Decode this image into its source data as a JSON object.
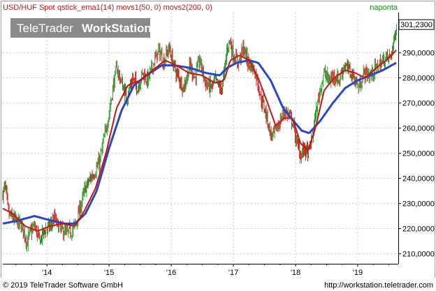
{
  "header": {
    "instrument": "USD/HUF Spot",
    "indicators": "qstick_ema1(14) movs1(50, 0) movs2(200, 0)",
    "frequency": "naponta"
  },
  "logo": {
    "part1": "TeleTrader",
    "part2": "WorkStation"
  },
  "footer": {
    "copyright": "© 2019 TeleTrader Software GmbH",
    "url": "http://workstation.teletrader.com"
  },
  "colors": {
    "up_candle": "#2e9b2e",
    "down_candle": "#cc1e1e",
    "movs1": "#c81414",
    "movs2": "#2a46c8",
    "grid": "#c9c9c9",
    "axis": "#000000",
    "logo_bg": "#8a8a8a",
    "header_text": "#c81414",
    "frequency_text": "#1a8c1a"
  },
  "chart_data": {
    "type": "candlestick",
    "x_axis_labels": [
      "'14",
      "'15",
      "'16",
      "'17",
      "'18",
      "'19"
    ],
    "y_tick_labels": [
      "210,0000",
      "220,0000",
      "230,0000",
      "240,0000",
      "250,0000",
      "260,0000",
      "270,0000",
      "280,0000",
      "290,0000"
    ],
    "ylim": [
      206,
      306
    ],
    "last_price_label": "301,2300",
    "last_price": 301.23,
    "grid": true,
    "price_series_name": "USD/HUF Spot",
    "price_anchors": [
      [
        2013.29,
        234
      ],
      [
        2013.33,
        237
      ],
      [
        2013.38,
        226
      ],
      [
        2013.45,
        224
      ],
      [
        2013.55,
        222
      ],
      [
        2013.62,
        220
      ],
      [
        2013.68,
        214
      ],
      [
        2013.72,
        218
      ],
      [
        2013.8,
        221
      ],
      [
        2013.88,
        215
      ],
      [
        2013.95,
        219
      ],
      [
        2014.05,
        221
      ],
      [
        2014.12,
        224
      ],
      [
        2014.2,
        220
      ],
      [
        2014.32,
        218
      ],
      [
        2014.4,
        219
      ],
      [
        2014.48,
        223
      ],
      [
        2014.55,
        230
      ],
      [
        2014.62,
        236
      ],
      [
        2014.7,
        240
      ],
      [
        2014.78,
        243
      ],
      [
        2014.85,
        247
      ],
      [
        2014.92,
        256
      ],
      [
        2015.0,
        266
      ],
      [
        2015.06,
        276
      ],
      [
        2015.12,
        284
      ],
      [
        2015.2,
        278
      ],
      [
        2015.28,
        272
      ],
      [
        2015.38,
        280
      ],
      [
        2015.46,
        276
      ],
      [
        2015.54,
        282
      ],
      [
        2015.62,
        279
      ],
      [
        2015.72,
        286
      ],
      [
        2015.8,
        291
      ],
      [
        2015.88,
        286
      ],
      [
        2015.96,
        292
      ],
      [
        2016.05,
        284
      ],
      [
        2016.12,
        280
      ],
      [
        2016.2,
        276
      ],
      [
        2016.3,
        285
      ],
      [
        2016.38,
        280
      ],
      [
        2016.46,
        287
      ],
      [
        2016.55,
        278
      ],
      [
        2016.63,
        276
      ],
      [
        2016.71,
        279
      ],
      [
        2016.8,
        275
      ],
      [
        2016.86,
        283
      ],
      [
        2016.9,
        292
      ],
      [
        2016.94,
        295
      ],
      [
        2017.0,
        289
      ],
      [
        2017.08,
        286
      ],
      [
        2017.16,
        292
      ],
      [
        2017.24,
        286
      ],
      [
        2017.32,
        284
      ],
      [
        2017.38,
        280
      ],
      [
        2017.44,
        272
      ],
      [
        2017.5,
        268
      ],
      [
        2017.56,
        262
      ],
      [
        2017.6,
        257
      ],
      [
        2017.66,
        258
      ],
      [
        2017.74,
        262
      ],
      [
        2017.82,
        267
      ],
      [
        2017.9,
        265
      ],
      [
        2017.96,
        262
      ],
      [
        2018.02,
        254
      ],
      [
        2018.08,
        249
      ],
      [
        2018.14,
        252
      ],
      [
        2018.2,
        250
      ],
      [
        2018.26,
        255
      ],
      [
        2018.32,
        265
      ],
      [
        2018.4,
        276
      ],
      [
        2018.46,
        282
      ],
      [
        2018.54,
        279
      ],
      [
        2018.62,
        281
      ],
      [
        2018.7,
        279
      ],
      [
        2018.78,
        285
      ],
      [
        2018.86,
        283
      ],
      [
        2018.94,
        280
      ],
      [
        2019.02,
        276
      ],
      [
        2019.1,
        282
      ],
      [
        2019.2,
        281
      ],
      [
        2019.3,
        284
      ],
      [
        2019.38,
        286
      ],
      [
        2019.46,
        288
      ],
      [
        2019.52,
        288
      ],
      [
        2019.58,
        294
      ],
      [
        2019.62,
        301.23
      ]
    ],
    "movs1_anchors": [
      [
        2013.29,
        228
      ],
      [
        2013.45,
        226
      ],
      [
        2013.65,
        221
      ],
      [
        2013.85,
        219
      ],
      [
        2014.05,
        221
      ],
      [
        2014.25,
        222
      ],
      [
        2014.45,
        221
      ],
      [
        2014.6,
        227
      ],
      [
        2014.78,
        236
      ],
      [
        2014.95,
        250
      ],
      [
        2015.12,
        268
      ],
      [
        2015.3,
        277
      ],
      [
        2015.5,
        279
      ],
      [
        2015.7,
        283
      ],
      [
        2015.9,
        287
      ],
      [
        2016.08,
        285
      ],
      [
        2016.28,
        282
      ],
      [
        2016.5,
        281
      ],
      [
        2016.7,
        278
      ],
      [
        2016.85,
        279
      ],
      [
        2016.95,
        287
      ],
      [
        2017.1,
        289
      ],
      [
        2017.25,
        287
      ],
      [
        2017.4,
        280
      ],
      [
        2017.55,
        270
      ],
      [
        2017.68,
        261
      ],
      [
        2017.82,
        264
      ],
      [
        2017.95,
        264
      ],
      [
        2018.08,
        254
      ],
      [
        2018.2,
        251
      ],
      [
        2018.32,
        260
      ],
      [
        2018.46,
        275
      ],
      [
        2018.62,
        280
      ],
      [
        2018.8,
        283
      ],
      [
        2018.96,
        282
      ],
      [
        2019.12,
        280
      ],
      [
        2019.3,
        284
      ],
      [
        2019.46,
        287
      ],
      [
        2019.62,
        291
      ]
    ],
    "movs2_anchors": [
      [
        2013.29,
        222
      ],
      [
        2013.5,
        223
      ],
      [
        2013.8,
        225
      ],
      [
        2014.1,
        223
      ],
      [
        2014.3,
        222
      ],
      [
        2014.45,
        222
      ],
      [
        2014.62,
        226
      ],
      [
        2014.8,
        235
      ],
      [
        2015.0,
        252
      ],
      [
        2015.2,
        267
      ],
      [
        2015.4,
        277
      ],
      [
        2015.6,
        281
      ],
      [
        2015.85,
        285
      ],
      [
        2016.05,
        285
      ],
      [
        2016.3,
        284
      ],
      [
        2016.55,
        282
      ],
      [
        2016.78,
        281
      ],
      [
        2016.9,
        284
      ],
      [
        2017.05,
        286
      ],
      [
        2017.25,
        287
      ],
      [
        2017.4,
        286
      ],
      [
        2017.6,
        279
      ],
      [
        2017.8,
        268
      ],
      [
        2017.96,
        263
      ],
      [
        2018.1,
        259
      ],
      [
        2018.22,
        258
      ],
      [
        2018.4,
        263
      ],
      [
        2018.6,
        270
      ],
      [
        2018.8,
        276
      ],
      [
        2019.0,
        279
      ],
      [
        2019.2,
        281
      ],
      [
        2019.4,
        283
      ],
      [
        2019.62,
        286
      ]
    ]
  }
}
